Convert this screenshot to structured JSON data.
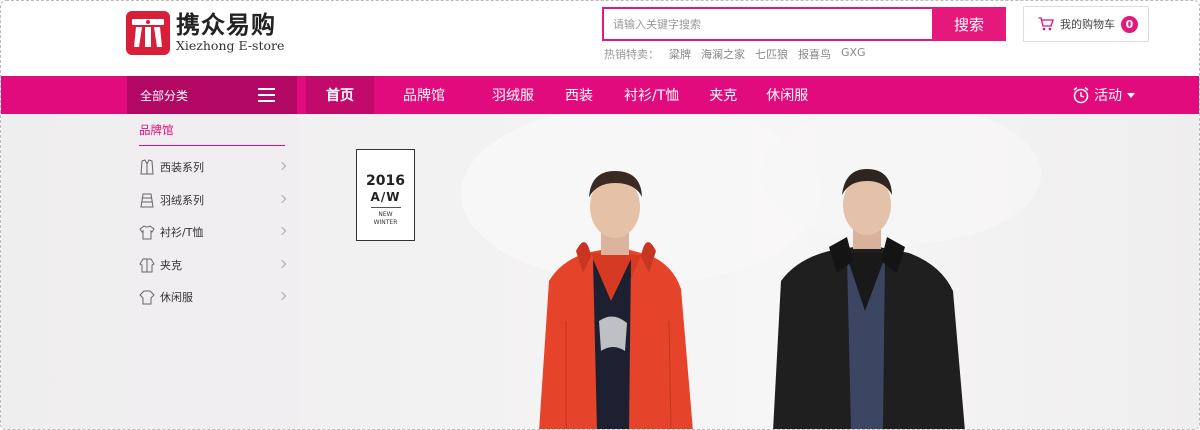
{
  "logo": {
    "cn": "携众易购",
    "en": "Xiezhong E-store"
  },
  "search": {
    "placeholder": "请输入关键字搜索",
    "button_label": "搜索"
  },
  "hot": {
    "label": "热销特卖：",
    "items": [
      "粱牌",
      "海澜之家",
      "七匹狼",
      "报喜鸟",
      "GXG"
    ]
  },
  "cart": {
    "label": "我的购物车",
    "count": "0"
  },
  "nav": {
    "category_label": "全部分类",
    "items": [
      {
        "label": "首页"
      },
      {
        "label": "品牌馆"
      },
      {
        "label": "羽绒服"
      },
      {
        "label": "西装"
      },
      {
        "label": "衬衫/T恤"
      },
      {
        "label": "夹克"
      },
      {
        "label": "休闲服"
      }
    ],
    "event_label": "活动"
  },
  "sidebar": {
    "title": "品牌馆",
    "items": [
      {
        "label": "西装系列",
        "icon": "suit-icon"
      },
      {
        "label": "羽绒系列",
        "icon": "down-jacket-icon"
      },
      {
        "label": "衬衫/T恤",
        "icon": "shirt-icon"
      },
      {
        "label": "夹克",
        "icon": "jacket-icon"
      },
      {
        "label": "休闲服",
        "icon": "casual-icon"
      }
    ]
  },
  "banner": {
    "year": "2016",
    "season": "A/W",
    "line1": "NEW",
    "line2": "WINTER"
  },
  "colors": {
    "accent": "#e20b7e",
    "accent_dark": "#b30764",
    "logo_red": "#d81f3a"
  }
}
